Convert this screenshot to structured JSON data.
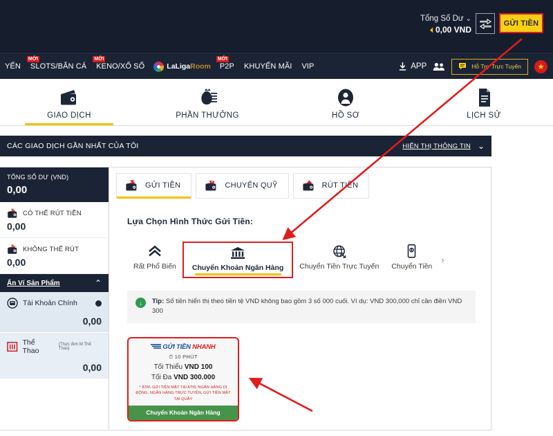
{
  "topbar": {
    "balance_label": "Tổng Số Dư",
    "balance_caret": "⌄",
    "balance_value": "0,00 VND",
    "refresh_icon": "refresh-icon",
    "transfer_icon": "transfer-arrows-icon",
    "deposit_button": "GỬI TIỀN",
    "deposit_button_bg": "#f9cf16",
    "highlight_color": "#e21b1b"
  },
  "nav": {
    "items": [
      {
        "label": "YẾN",
        "badge": ""
      },
      {
        "label": "SLOTS/BẮN CÁ",
        "badge": "MỚI"
      },
      {
        "label": "KENO/XỔ SỐ",
        "badge": "MỚI"
      },
      {
        "label": "P2P",
        "badge": "MỚI"
      },
      {
        "label": "KHUYẾN MÃI",
        "badge": ""
      },
      {
        "label": "VIP",
        "badge": ""
      }
    ],
    "laliga_main": "LaLiga",
    "laliga_sub": "Room",
    "app_label": "APP",
    "download_icon": "download-icon",
    "friends_icon": "people-icon",
    "support_label": "Hỗ Trợ Trực Tuyến",
    "support_icon": "chat-icon",
    "star_icon": "★"
  },
  "main_tabs": [
    {
      "label": "GIAO DỊCH",
      "icon": "wallet-icon",
      "active": true
    },
    {
      "label": "PHẦN THƯỞNG",
      "icon": "money-bag-icon",
      "active": false
    },
    {
      "label": "HỒ SƠ",
      "icon": "user-profile-icon",
      "active": false
    },
    {
      "label": "LỊCH SỬ",
      "icon": "document-icon",
      "active": false
    }
  ],
  "section_header": {
    "title": "CÁC GIAO DỊCH GẦN NHẤT CỦA TÔI",
    "link": "HIỂN THỊ THÔNG TIN",
    "chevron": "⌄"
  },
  "sidebar": {
    "total_label": "TỔNG SỐ DƯ",
    "total_currency": "(VND)",
    "total_value": "0,00",
    "rows": [
      {
        "label": "CÓ THỂ RÚT TIỀN",
        "value": "0,00",
        "icon": "wallet-up-icon"
      },
      {
        "label": "KHÔNG THỂ RÚT",
        "value": "0,00",
        "icon": "wallet-down-icon"
      }
    ],
    "section_title": "Ẩn Ví Sản Phẩm",
    "section_chevron": "⌃",
    "products": [
      {
        "name": "Tài Khoản Chính",
        "sub": "",
        "value": "0,00",
        "icon": "main-account-icon",
        "selected": true
      },
      {
        "name": "Thể Thao",
        "sub": "(Thực đơn M Thể Thao)",
        "value": "0,00",
        "icon": "sports-icon",
        "selected": false
      }
    ]
  },
  "content": {
    "subtabs": [
      {
        "label": "GỬI TIỀN",
        "icon": "wallet-deposit-icon",
        "active": true
      },
      {
        "label": "CHUYỂN QUỸ",
        "icon": "wallet-transfer-icon",
        "active": false
      },
      {
        "label": "RÚT TIỀN",
        "icon": "wallet-withdraw-icon",
        "active": false
      }
    ],
    "panel_title": "Lựa Chọn Hình Thức Gửi Tiền:",
    "methods": [
      {
        "label": "Rất Phổ Biến",
        "icon": "double-chevron-up-icon",
        "selected": false
      },
      {
        "label": "Chuyển Khoản Ngân Hàng",
        "icon": "bank-icon",
        "selected": true
      },
      {
        "label": "Chuyển Tiền Trực Tuyến",
        "icon": "globe-icon",
        "selected": false
      },
      {
        "label": "Chuyển Tiền",
        "icon": "mobile-icon",
        "selected": false
      }
    ],
    "method_next": "›",
    "tip": {
      "icon": "info-icon",
      "label": "Tip:",
      "text": " Số tiền hiển thị theo tiền tệ VND không bao gồm 3 số 000 cuối. Ví dụ: VND 300,000 chỉ cần điền VND 300"
    },
    "promo": {
      "brand_prefix": "GỬI TIỀN",
      "brand_suffix": "NHANH",
      "time_icon": "clock-icon",
      "time": "10 PHÚT",
      "min_label": "Tối Thiểu",
      "min_value": "VND 100",
      "max_label": "Tối Đa",
      "max_value": "VND 300.000",
      "note": "* ATM, GỬI TIỀN MẶT TẠI ATM, NGÂN HÀNG DI ĐỘNG, NGÂN HÀNG TRỰC TUYẾN, GỬI TIỀN MẶT TẠI QUẦY",
      "footer": "Chuyển Khoản Ngân Hàng",
      "footer_bg": "#47934a"
    }
  },
  "annotations": {
    "arrow_color": "#e21b1b",
    "arrow_count": 2
  }
}
